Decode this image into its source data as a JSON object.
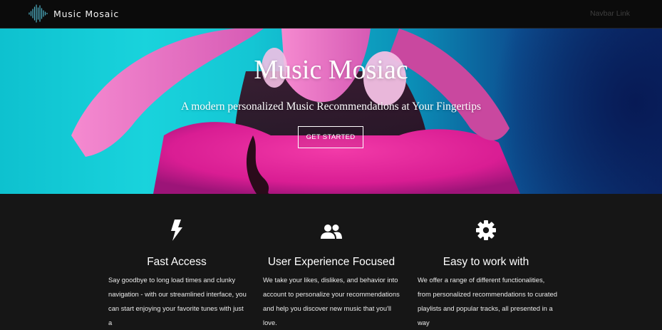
{
  "navbar": {
    "brand": "Music Mosaic",
    "link": "Navbar Link"
  },
  "hero": {
    "title": "Music Mosiac",
    "subtitle": "A modern personalized Music Recommendations at Your Fingertips",
    "cta": "GET STARTED"
  },
  "features": [
    {
      "icon": "lightning-bolt-icon",
      "title": "Fast Access",
      "text": "Say goodbye to long load times and clunky navigation - with our streamlined interface, you can start enjoying your favorite tunes with just a"
    },
    {
      "icon": "users-icon",
      "title": "User Experience Focused",
      "text": "We take your likes, dislikes, and behavior into account to personalize your recommendations and help you discover new music that you'll love."
    },
    {
      "icon": "gear-icon",
      "title": "Easy to work with",
      "text": "We offer a range of different functionalities, from personalized recommendations to curated playlists and popular tracks, all presented in a way"
    }
  ],
  "colors": {
    "navbar_bg": "#0b0b0b",
    "page_bg": "#161616",
    "hero_cyan": "#19d3dc",
    "hero_navy": "#0c2a6b",
    "hero_magenta": "#e81f9a",
    "brand_wave": "#4fb3c8"
  }
}
